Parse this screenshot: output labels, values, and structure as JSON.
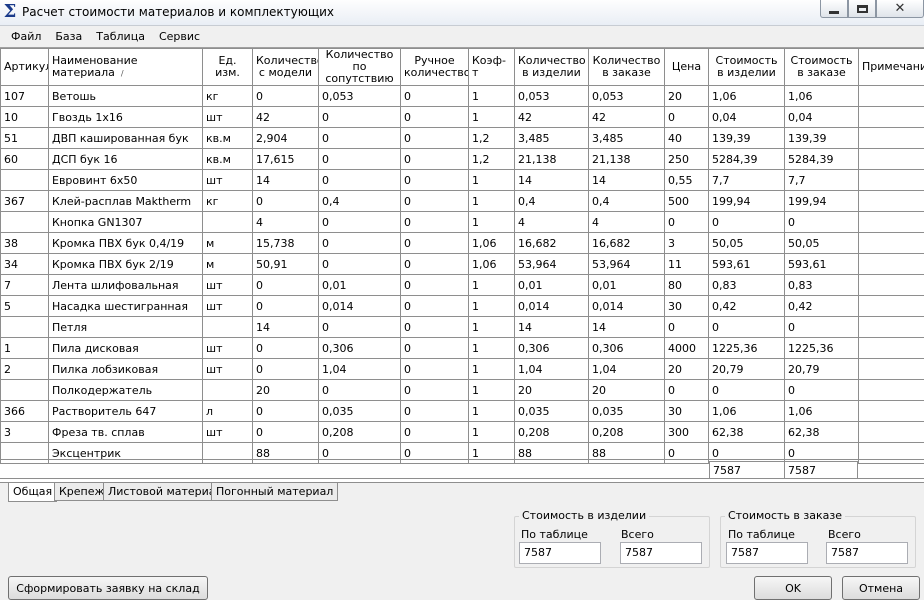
{
  "window": {
    "title": "Расчет стоимости материалов и комплектующих",
    "icon": "sigma-icon"
  },
  "menu": [
    "Файл",
    "База",
    "Таблица",
    "Сервис"
  ],
  "columns": [
    "Артикул",
    "Наименование материала",
    "Ед. изм.",
    "Количество с модели",
    "Количество по сопутствию",
    "Ручное количество",
    "Коэф-т",
    "Количество в изделии",
    "Количество в заказе",
    "Цена",
    "Стоимость в изделии",
    "Стоимость в заказе",
    "Примечание"
  ],
  "rows": [
    [
      "107",
      "Ветошь",
      "кг",
      "0",
      "0,053",
      "0",
      "1",
      "0,053",
      "0,053",
      "20",
      "1,06",
      "1,06",
      ""
    ],
    [
      "10",
      "Гвоздь 1х16",
      "шт",
      "42",
      "0",
      "0",
      "1",
      "42",
      "42",
      "0",
      "0,04",
      "0,04",
      ""
    ],
    [
      "51",
      "ДВП кашированная бук",
      "кв.м",
      "2,904",
      "0",
      "0",
      "1,2",
      "3,485",
      "3,485",
      "40",
      "139,39",
      "139,39",
      ""
    ],
    [
      "60",
      "ДСП бук 16",
      "кв.м",
      "17,615",
      "0",
      "0",
      "1,2",
      "21,138",
      "21,138",
      "250",
      "5284,39",
      "5284,39",
      ""
    ],
    [
      "",
      "Евровинт 6х50",
      "шт",
      "14",
      "0",
      "0",
      "1",
      "14",
      "14",
      "0,55",
      "7,7",
      "7,7",
      ""
    ],
    [
      "367",
      "Клей-расплав Maktherm",
      "кг",
      "0",
      "0,4",
      "0",
      "1",
      "0,4",
      "0,4",
      "500",
      "199,94",
      "199,94",
      ""
    ],
    [
      "",
      "Кнопка GN1307",
      "",
      "4",
      "0",
      "0",
      "1",
      "4",
      "4",
      "0",
      "0",
      "0",
      ""
    ],
    [
      "38",
      "Кромка ПВХ бук 0,4/19",
      "м",
      "15,738",
      "0",
      "0",
      "1,06",
      "16,682",
      "16,682",
      "3",
      "50,05",
      "50,05",
      ""
    ],
    [
      "34",
      "Кромка ПВХ бук 2/19",
      "м",
      "50,91",
      "0",
      "0",
      "1,06",
      "53,964",
      "53,964",
      "11",
      "593,61",
      "593,61",
      ""
    ],
    [
      "7",
      "Лента шлифовальная",
      "шт",
      "0",
      "0,01",
      "0",
      "1",
      "0,01",
      "0,01",
      "80",
      "0,83",
      "0,83",
      ""
    ],
    [
      "5",
      "Насадка шестигранная",
      "шт",
      "0",
      "0,014",
      "0",
      "1",
      "0,014",
      "0,014",
      "30",
      "0,42",
      "0,42",
      ""
    ],
    [
      "",
      "Петля",
      "",
      "14",
      "0",
      "0",
      "1",
      "14",
      "14",
      "0",
      "0",
      "0",
      ""
    ],
    [
      "1",
      "Пила дисковая",
      "шт",
      "0",
      "0,306",
      "0",
      "1",
      "0,306",
      "0,306",
      "4000",
      "1225,36",
      "1225,36",
      ""
    ],
    [
      "2",
      "Пилка лобзиковая",
      "шт",
      "0",
      "1,04",
      "0",
      "1",
      "1,04",
      "1,04",
      "20",
      "20,79",
      "20,79",
      ""
    ],
    [
      "",
      "Полкодержатель",
      "",
      "20",
      "0",
      "0",
      "1",
      "20",
      "20",
      "0",
      "0",
      "0",
      ""
    ],
    [
      "366",
      "Растворитель 647",
      "л",
      "0",
      "0,035",
      "0",
      "1",
      "0,035",
      "0,035",
      "30",
      "1,06",
      "1,06",
      ""
    ],
    [
      "3",
      "Фреза тв. сплав",
      "шт",
      "0",
      "0,208",
      "0",
      "1",
      "0,208",
      "0,208",
      "300",
      "62,38",
      "62,38",
      ""
    ],
    [
      "",
      "Эксцентрик",
      "",
      "88",
      "0",
      "0",
      "1",
      "88",
      "88",
      "0",
      "0",
      "0",
      ""
    ]
  ],
  "totals": {
    "item": "7587",
    "order": "7587"
  },
  "tabs": [
    "Общая",
    "Крепеж",
    "Листовой материал",
    "Погонный материал"
  ],
  "cost_item": {
    "title": "Стоимость в изделии",
    "by_table_label": "По таблице",
    "by_table_value": "7587",
    "total_label": "Всего",
    "total_value": "7587"
  },
  "cost_order": {
    "title": "Стоимость в заказе",
    "by_table_label": "По таблице",
    "by_table_value": "7587",
    "total_label": "Всего",
    "total_value": "7587"
  },
  "buttons": {
    "create_request": "Сформировать заявку на склад",
    "ok": "OK",
    "cancel": "Отмена"
  }
}
